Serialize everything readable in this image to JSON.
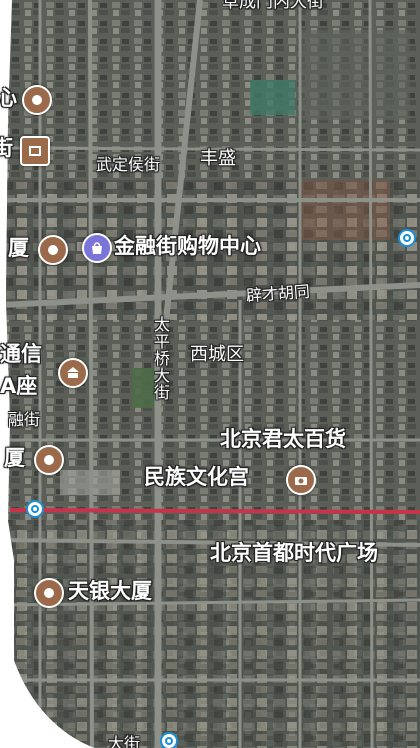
{
  "map": {
    "type": "satellite",
    "district": "西城区",
    "roads": {
      "top_partial": "阜成门内大街",
      "wudinghou": "武定侯街",
      "fengsheng": "丰盛",
      "pixaihutong": "辟才胡同",
      "taipingqiao": "太平桥大街",
      "jinrong_partial": "融街",
      "bottom_partial": "大街"
    },
    "pois": [
      {
        "key": "left_top",
        "label": "心",
        "icon": "building-icon",
        "color": "#9b6a4a"
      },
      {
        "key": "left_mid",
        "label": "厦",
        "icon": "building-icon",
        "color": "#9b6a4a"
      },
      {
        "key": "jinrong_mall",
        "label": "金融街购物中心",
        "icon": "shopping-bag-icon",
        "color": "#7b74d9"
      },
      {
        "key": "tongxin",
        "label": "通信",
        "label2": "A座",
        "icon": "landmark-icon",
        "color": "#9b6a4a"
      },
      {
        "key": "left_low",
        "label": "厦",
        "icon": "building-icon",
        "color": "#9b6a4a"
      },
      {
        "key": "junai",
        "label": "北京君太百货",
        "icon": "",
        "color": ""
      },
      {
        "key": "minzu",
        "label": "民族文化宫",
        "icon": "camera-icon",
        "color": "#9b6a4a"
      },
      {
        "key": "shoudu",
        "label": "北京首都时代广场",
        "icon": "",
        "color": ""
      },
      {
        "key": "tianyin",
        "label": "天银大厦",
        "icon": "building-icon",
        "color": "#9b6a4a"
      },
      {
        "key": "left_tag",
        "label": "街",
        "icon": "bank-icon",
        "color": "#9b6a4a"
      }
    ],
    "metro_icon": "metro-icon",
    "metro_line_color": "#c8334a"
  }
}
